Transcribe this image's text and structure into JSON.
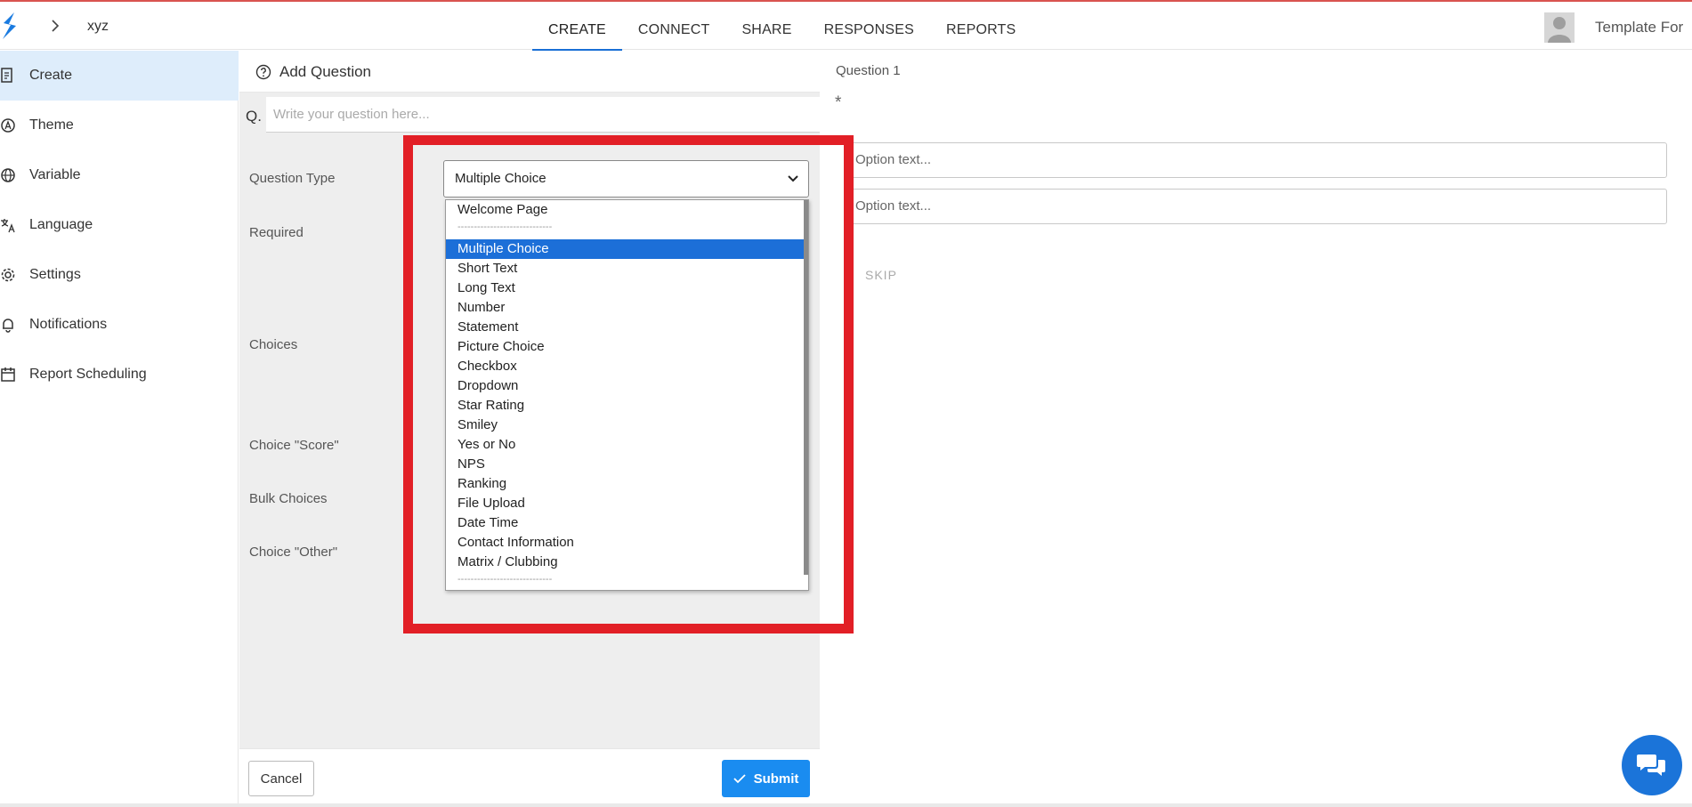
{
  "header": {
    "breadcrumb": "xyz",
    "tabs": [
      {
        "label": "CREATE",
        "active": true
      },
      {
        "label": "CONNECT",
        "active": false
      },
      {
        "label": "SHARE",
        "active": false
      },
      {
        "label": "RESPONSES",
        "active": false
      },
      {
        "label": "REPORTS",
        "active": false
      }
    ],
    "user_name": "Template For"
  },
  "sidebar": {
    "items": [
      {
        "label": "Create",
        "icon": "form-icon",
        "active": true
      },
      {
        "label": "Theme",
        "icon": "theme-icon"
      },
      {
        "label": "Variable",
        "icon": "globe-icon"
      },
      {
        "label": "Language",
        "icon": "translate-icon"
      },
      {
        "label": "Settings",
        "icon": "gear-icon"
      },
      {
        "label": "Notifications",
        "icon": "bell-icon"
      },
      {
        "label": "Report Scheduling",
        "icon": "calendar-icon"
      }
    ]
  },
  "editor": {
    "title": "Add Question",
    "q_prefix": "Q.",
    "q_placeholder": "Write your question here...",
    "labels": {
      "question_type": "Question Type",
      "required": "Required",
      "choices": "Choices",
      "choice_score": "Choice \"Score\"",
      "bulk_choices": "Bulk Choices",
      "choice_other": "Choice \"Other\""
    },
    "question_type_value": "Multiple Choice",
    "dropdown": {
      "options": [
        "Welcome Page",
        "-----------------------------",
        "Multiple Choice",
        "Short Text",
        "Long Text",
        "Number",
        "Statement",
        "Picture Choice",
        "Checkbox",
        "Dropdown",
        "Star Rating",
        "Smiley",
        "Yes or No",
        "NPS",
        "Ranking",
        "File Upload",
        "Date Time",
        "Contact Information",
        "Matrix / Clubbing",
        "-----------------------------"
      ],
      "selected": "Multiple Choice"
    },
    "cancel_label": "Cancel",
    "submit_label": "Submit"
  },
  "preview": {
    "question_number": "Question 1",
    "required_mark": "*",
    "option_placeholder_1": "Option text...",
    "option_placeholder_2": "Option text...",
    "skip_label": "SKIP"
  },
  "colors": {
    "accent": "#1a6fd6",
    "submit": "#1a8cf0",
    "highlight": "#e21f26",
    "sidebar_active": "#deedfb",
    "selected_option": "#1c6fd8"
  }
}
